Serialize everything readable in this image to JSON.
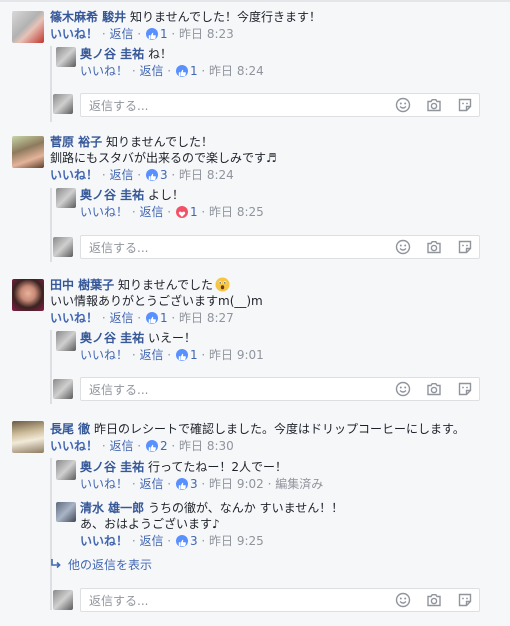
{
  "labels": {
    "like": "いいね！",
    "reply": "返信",
    "sep": " · ",
    "reply_placeholder": "返信する...",
    "more_replies": "他の返信を表示",
    "edited": "編集済み"
  },
  "threads": [
    {
      "author": "篠木麻希 駿井",
      "text": "知りませんでした！今度行きます！",
      "likes": "1",
      "time": "昨日 8:23",
      "replies": [
        {
          "author": "奥ノ谷 圭祐",
          "text": "ね！",
          "likes": "1",
          "time": "昨日 8:24"
        }
      ]
    },
    {
      "author": "菅原 裕子",
      "text": "知りませんでした！",
      "text2": "釧路にもスタバが出来るので楽しみです♬",
      "likes": "3",
      "time": "昨日 8:24",
      "replies": [
        {
          "author": "奥ノ谷 圭祐",
          "text": "よし！",
          "likes": "1",
          "time": "昨日 8:25"
        }
      ]
    },
    {
      "author": "田中 樹葉子",
      "text": "知りませんでした",
      "text2": "いい情報ありがとうございますm(__)m",
      "likes": "1",
      "time": "昨日 8:27",
      "replies": [
        {
          "author": "奥ノ谷 圭祐",
          "text": "いえー！",
          "likes": "1",
          "time": "昨日 9:01"
        }
      ]
    },
    {
      "author": "長尾 徹",
      "text": "昨日のレシートで確認しました。今度はドリップコーヒーにします。",
      "likes": "2",
      "time": "昨日 8:30",
      "replies": [
        {
          "author": "奥ノ谷 圭祐",
          "text": "行ってたねー！2人でー！",
          "likes": "3",
          "time": "昨日 9:02"
        },
        {
          "author": "清水 雄一郎",
          "text": "うちの徹が、なんか すいません！！",
          "text2": "あ、おはようございます♪",
          "likes": "3",
          "time": "昨日 9:25"
        }
      ]
    }
  ]
}
